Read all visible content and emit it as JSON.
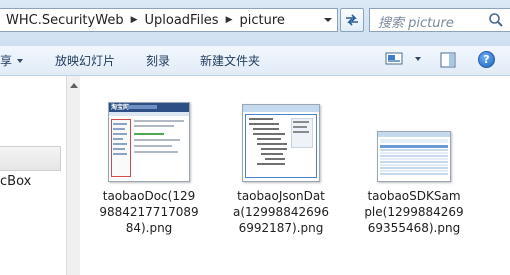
{
  "address": {
    "crumbs": [
      "WHC.SecurityWeb",
      "UploadFiles",
      "picture"
    ]
  },
  "search": {
    "placeholder": "搜索 picture"
  },
  "toolbar": {
    "share_label": "享",
    "slideshow_label": "放映幻灯片",
    "burn_label": "刻录",
    "new_folder_label": "新建文件夹"
  },
  "nav": {
    "partial_item": "cBox"
  },
  "files": [
    {
      "name_lines": [
        "taobaoDoc(129",
        "9884217717089",
        "84).png"
      ]
    },
    {
      "name_lines": [
        "taobaoJsonDat",
        "a(12998842696",
        "6992187).png"
      ]
    },
    {
      "name_lines": [
        "taobaoSDKSam",
        "ple(1299884269",
        "69355468).png"
      ]
    }
  ],
  "thumb_texts": {
    "doc_logo": "淘宝网"
  },
  "colors": {
    "accent": "#1b5fb8",
    "address_bg": "#dbe8f6",
    "toolbar_text": "#1e3b5c"
  }
}
